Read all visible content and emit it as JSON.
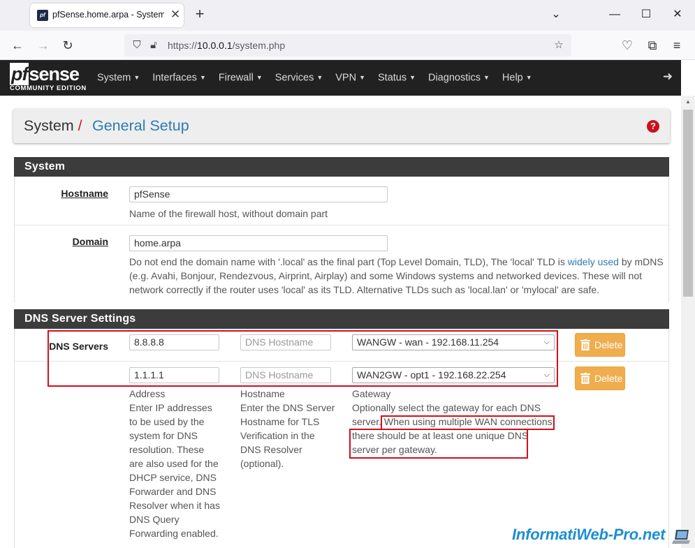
{
  "browser": {
    "tab_title": "pfSense.home.arpa - System: G",
    "tab_favicon": "pf",
    "url_prefix": "https://",
    "url_host": "10.0.0.1",
    "url_path": "/system.php"
  },
  "header": {
    "logo_main": "sense",
    "logo_pf": "pf",
    "logo_sub": "COMMUNITY EDITION",
    "menu": [
      "System",
      "Interfaces",
      "Firewall",
      "Services",
      "VPN",
      "Status",
      "Diagnostics",
      "Help"
    ]
  },
  "breadcrumb": {
    "section": "System",
    "separator": "/",
    "page": "General Setup"
  },
  "system_panel": {
    "title": "System",
    "hostname_label": "Hostname",
    "hostname_value": "pfSense",
    "hostname_help": "Name of the firewall host, without domain part",
    "domain_label": "Domain",
    "domain_value": "home.arpa",
    "domain_help_1": "Do not end the domain name with '.local' as the final part (Top Level Domain, TLD), The 'local' TLD is ",
    "domain_help_link": "widely used",
    "domain_help_2": " by mDNS",
    "domain_help_3": "(e.g. Avahi, Bonjour, Rendezvous, Airprint, Airplay) and some Windows systems and networked devices. These will not",
    "domain_help_4": "network correctly if the router uses 'local' as its TLD. Alternative TLDs such as 'local.lan' or 'mylocal' are safe."
  },
  "dns_panel": {
    "title": "DNS Server Settings",
    "dns_label": "DNS Servers",
    "rows": [
      {
        "address": "8.8.8.8",
        "hostname_placeholder": "DNS Hostname",
        "gateway": "WANGW - wan - 192.168.11.254",
        "delete_label": "Delete"
      },
      {
        "address": "1.1.1.1",
        "hostname_placeholder": "DNS Hostname",
        "gateway": "WAN2GW - opt1 - 192.168.22.254",
        "delete_label": "Delete"
      }
    ],
    "address_col": {
      "title": "Address",
      "lines": [
        "Enter IP addresses",
        "to be used by the",
        "system for DNS",
        "resolution. These",
        "are also used for the",
        "DHCP service, DNS",
        "Forwarder and DNS",
        "Resolver when it has",
        "DNS Query",
        "Forwarding enabled."
      ]
    },
    "hostname_col": {
      "title": "Hostname",
      "lines": [
        "Enter the DNS Server",
        "Hostname for TLS",
        "Verification in the",
        "DNS Resolver",
        "(optional)."
      ]
    },
    "gateway_col": {
      "title": "Gateway",
      "lines": [
        "Optionally select the gateway for each DNS",
        "server. When using multiple WAN connections",
        "there should be at least one unique DNS",
        "server per gateway."
      ]
    }
  },
  "watermark": "InformatiWeb-Pro.net",
  "colors": {
    "accent": "#2e7bb4",
    "header_bg": "#212121",
    "panel_head": "#3c3c3c",
    "delete_button": "#f0ad4e",
    "highlight_box": "#d0101a"
  }
}
